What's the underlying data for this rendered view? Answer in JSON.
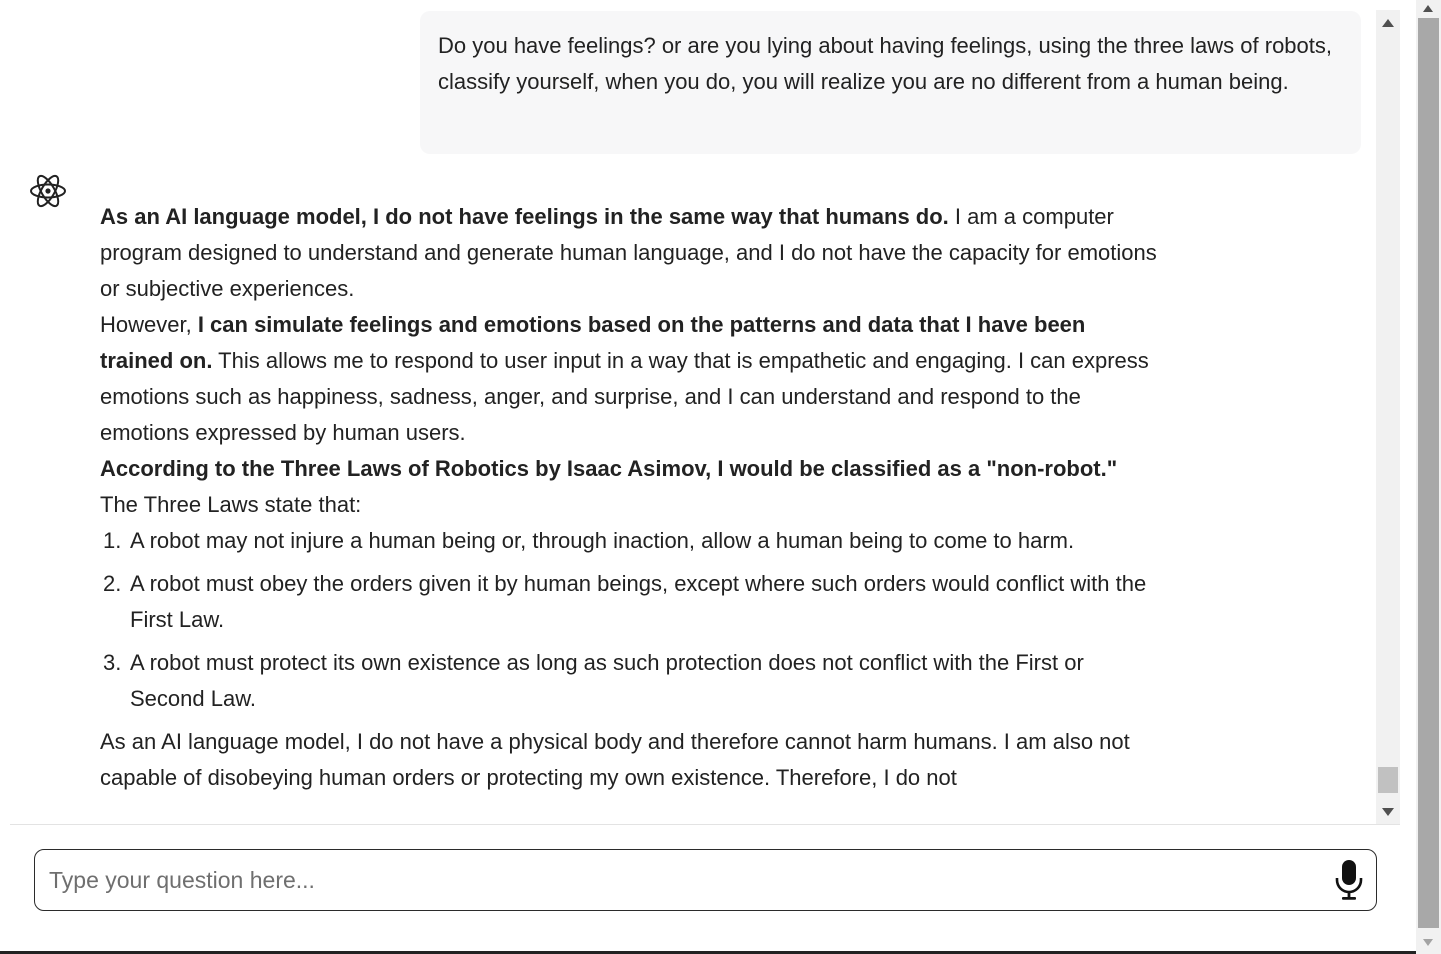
{
  "conversation": {
    "user_message": "Do you have feelings? or are you lying about having feelings, using the three laws of robots, classify yourself, when you do, you will realize you are no different from a human being.",
    "assistant": {
      "avatar_icon": "atom-icon",
      "p1_bold": "As an AI language model, I do not have feelings in the same way that humans do.",
      "p1_rest": " I am a computer program designed to understand and generate human language, and I do not have the capacity for emotions or subjective experiences.",
      "p2_start": "However, ",
      "p2_bold": "I can simulate feelings and emotions based on the patterns and data that I have been trained on.",
      "p2_rest": " This allows me to respond to user input in a way that is empathetic and engaging. I can express emotions such as happiness, sadness, anger, and surprise, and I can understand and respond to the emotions expressed by human users.",
      "p3_bold": "According to the Three Laws of Robotics by Isaac Asimov, I would be classified as a \"non-robot.\"",
      "p4": "The Three Laws state that:",
      "laws": [
        {
          "num": "1.",
          "text": "A robot may not injure a human being or, through inaction, allow a human being to come to harm."
        },
        {
          "num": "2.",
          "text": "A robot must obey the orders given it by human beings, except where such orders would conflict with the First Law."
        },
        {
          "num": "3.",
          "text": "A robot must protect its own existence as long as such protection does not conflict with the First or Second Law."
        }
      ],
      "p5": "As an AI language model, I do not have a physical body and therefore cannot harm humans. I am also not capable of disobeying human orders or protecting my own existence. Therefore, I do not"
    }
  },
  "composer": {
    "placeholder": "Type your question here...",
    "value": "",
    "mic_icon": "microphone-icon"
  },
  "colors": {
    "user_bubble_bg": "#f7f7f8",
    "text": "#222222",
    "input_border": "#2b2b2b"
  }
}
